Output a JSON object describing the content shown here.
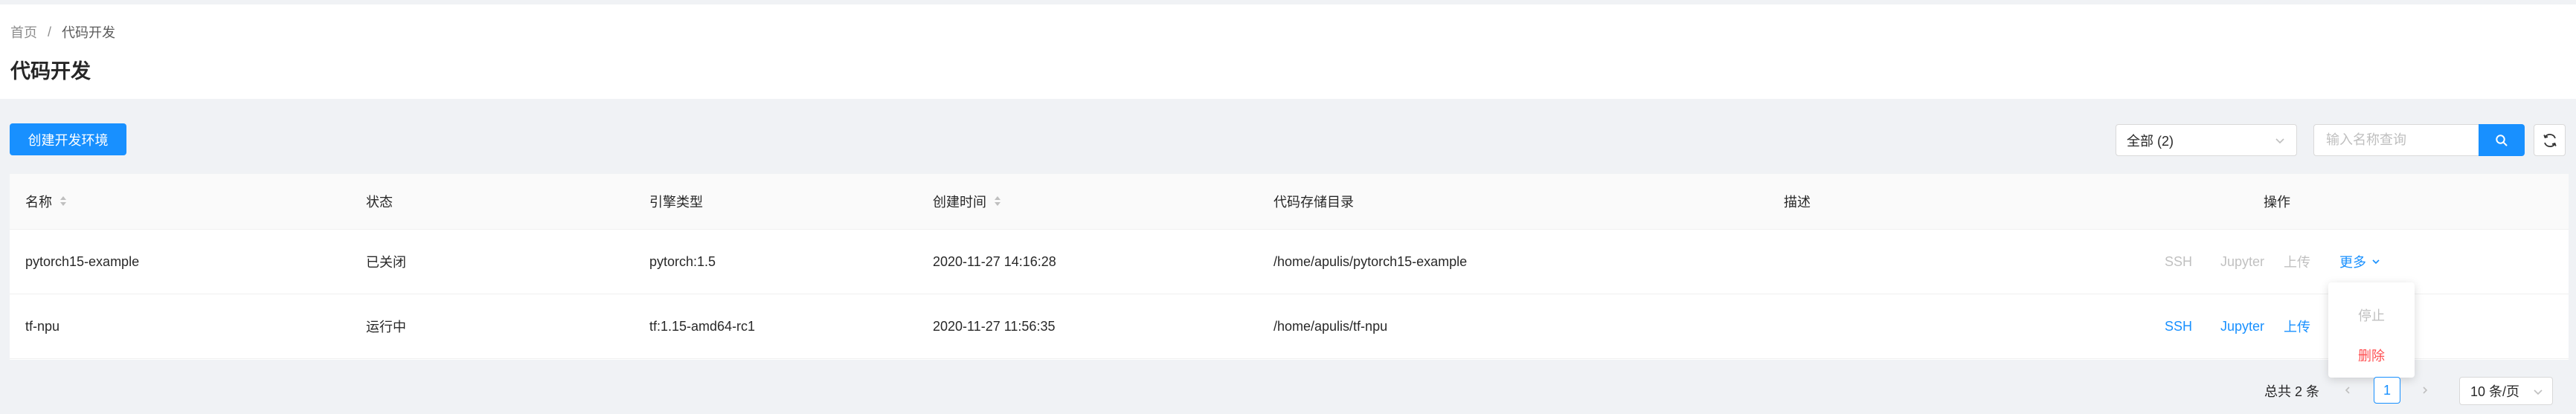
{
  "breadcrumb": {
    "home": "首页",
    "separator": "/",
    "current": "代码开发"
  },
  "page": {
    "title": "代码开发"
  },
  "toolbar": {
    "create_label": "创建开发环境",
    "filter_value": "全部 (2)",
    "search_placeholder": "输入名称查询"
  },
  "table": {
    "headers": [
      "名称",
      "状态",
      "引擎类型",
      "创建时间",
      "代码存储目录",
      "描述",
      "操作"
    ],
    "rows": [
      {
        "name": "pytorch15-example",
        "status": "已关闭",
        "engine": "pytorch:1.5",
        "created": "2020-11-27 14:16:28",
        "dir": "/home/apulis/pytorch15-example",
        "desc": "",
        "actions": {
          "ssh": "SSH",
          "jupyter": "Jupyter",
          "upload": "上传",
          "more": "更多"
        },
        "actions_enabled": false
      },
      {
        "name": "tf-npu",
        "status": "运行中",
        "engine": "tf:1.15-amd64-rc1",
        "created": "2020-11-27 11:56:35",
        "dir": "/home/apulis/tf-npu",
        "desc": "",
        "actions": {
          "ssh": "SSH",
          "jupyter": "Jupyter",
          "upload": "上传"
        },
        "actions_enabled": true
      }
    ]
  },
  "dropdown": {
    "stop": "停止",
    "delete": "删除"
  },
  "pagination": {
    "total": "总共 2 条",
    "current_page": "1",
    "page_size": "10 条/页"
  },
  "colors": {
    "primary": "#1890ff",
    "danger": "#ff4d4f",
    "background": "#f0f2f5"
  },
  "icons": [
    "search-icon",
    "reload-icon",
    "chevron-down-icon",
    "sort-icon",
    "left-arrow-icon",
    "right-arrow-icon"
  ]
}
